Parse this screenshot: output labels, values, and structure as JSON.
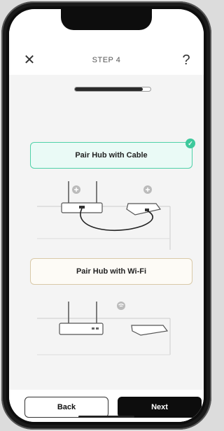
{
  "header": {
    "close_icon": "close-icon",
    "step_title": "STEP 4",
    "help_label": "?"
  },
  "progress": {
    "value": 0.9
  },
  "options": {
    "cable": {
      "label": "Pair Hub with Cable",
      "selected": true,
      "check_icon": "checkmark-icon"
    },
    "wifi": {
      "label": "Pair Hub with Wi-Fi",
      "selected": false
    }
  },
  "footer": {
    "back_label": "Back",
    "next_label": "Next"
  },
  "colors": {
    "accent_green": "#3ec99c",
    "selected_border": "#4fd1a8",
    "unselected_border": "#d9c9a8",
    "primary_button": "#0d0d0d"
  }
}
